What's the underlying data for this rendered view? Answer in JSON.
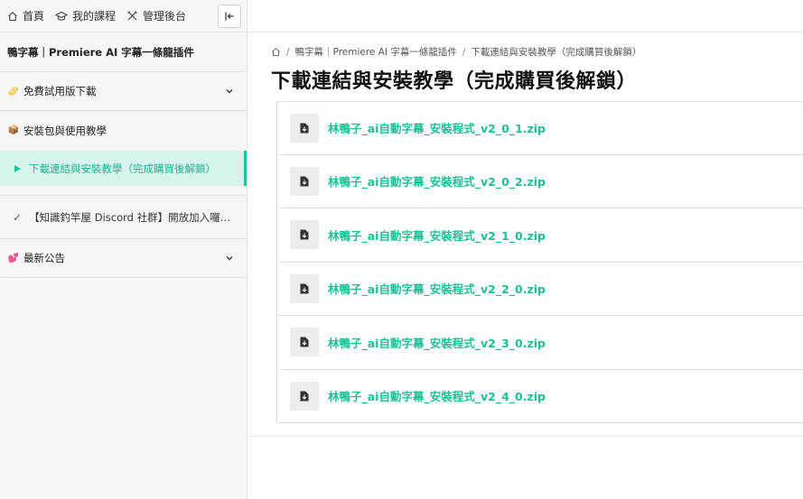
{
  "topnav": {
    "home": "首頁",
    "my_courses": "我的課程",
    "admin": "管理後台"
  },
  "sidebar": {
    "course_title": "鴨字幕｜Premiere AI 字幕一條龍插件",
    "sections": [
      {
        "emoji": "🫔",
        "label": "免費試用版下載"
      },
      {
        "emoji": "📦",
        "label": "安裝包與使用教學"
      }
    ],
    "active_lesson": "下載連結與安裝教學（完成購買後解鎖）",
    "done_lesson": {
      "check": "✓",
      "label": "【知識釣竿屋 Discord 社群】開放加入囉！..."
    },
    "last_section": {
      "emoji": "💕",
      "label": "最新公告"
    }
  },
  "breadcrumb": {
    "course": "鴨字幕｜Premiere AI 字幕一條龍插件",
    "lesson": "下載連結與安裝教學（完成購買後解鎖）",
    "sep": "/"
  },
  "page_title": "下載連結與安裝教學（完成購買後解鎖）",
  "files": [
    "林鴨子_ai自動字幕_安裝程式_v2_0_1.zip",
    "林鴨子_ai自動字幕_安裝程式_v2_0_2.zip",
    "林鴨子_ai自動字幕_安裝程式_v2_1_0.zip",
    "林鴨子_ai自動字幕_安裝程式_v2_2_0.zip",
    "林鴨子_ai自動字幕_安裝程式_v2_3_0.zip",
    "林鴨子_ai自動字幕_安裝程式_v2_4_0.zip"
  ],
  "colors": {
    "accent": "#1cc49b",
    "active_bg": "#d7f4ec",
    "sidebar_bg": "#f6f6f6"
  }
}
